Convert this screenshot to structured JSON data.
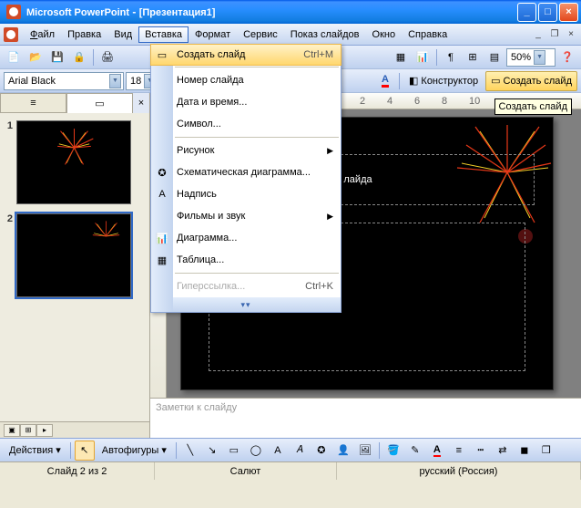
{
  "window": {
    "app": "Microsoft PowerPoint",
    "doc": "[Презентация1]"
  },
  "menubar": {
    "file": "Файл",
    "edit": "Правка",
    "view": "Вид",
    "insert": "Вставка",
    "format": "Формат",
    "tools": "Сервис",
    "slideshow": "Показ слайдов",
    "window": "Окно",
    "help": "Справка"
  },
  "toolbar": {
    "zoom": "50%"
  },
  "format_bar": {
    "font": "Arial Black",
    "size": "18",
    "designer": "Конструктор",
    "newslide": "Создать слайд"
  },
  "dropdown": {
    "new_slide": "Создать слайд",
    "new_slide_sc": "Ctrl+M",
    "slide_number": "Номер слайда",
    "date_time": "Дата и время...",
    "symbol": "Символ...",
    "picture": "Рисунок",
    "diagram": "Схематическая диаграмма...",
    "textbox": "Надпись",
    "movies": "Фильмы и звук",
    "chart": "Диаграмма...",
    "table": "Таблица...",
    "hyperlink": "Гиперссылка...",
    "hyperlink_sc": "Ctrl+K"
  },
  "tooltip": "Создать слайд",
  "thumbs": {
    "n1": "1",
    "n2": "2"
  },
  "slide": {
    "title_fragment": "лайда"
  },
  "notes": "Заметки к слайду",
  "drawbar": {
    "actions": "Действия",
    "autoshapes": "Автофигуры"
  },
  "status": {
    "slide": "Слайд 2 из 2",
    "template": "Салют",
    "lang": "русский (Россия)"
  }
}
